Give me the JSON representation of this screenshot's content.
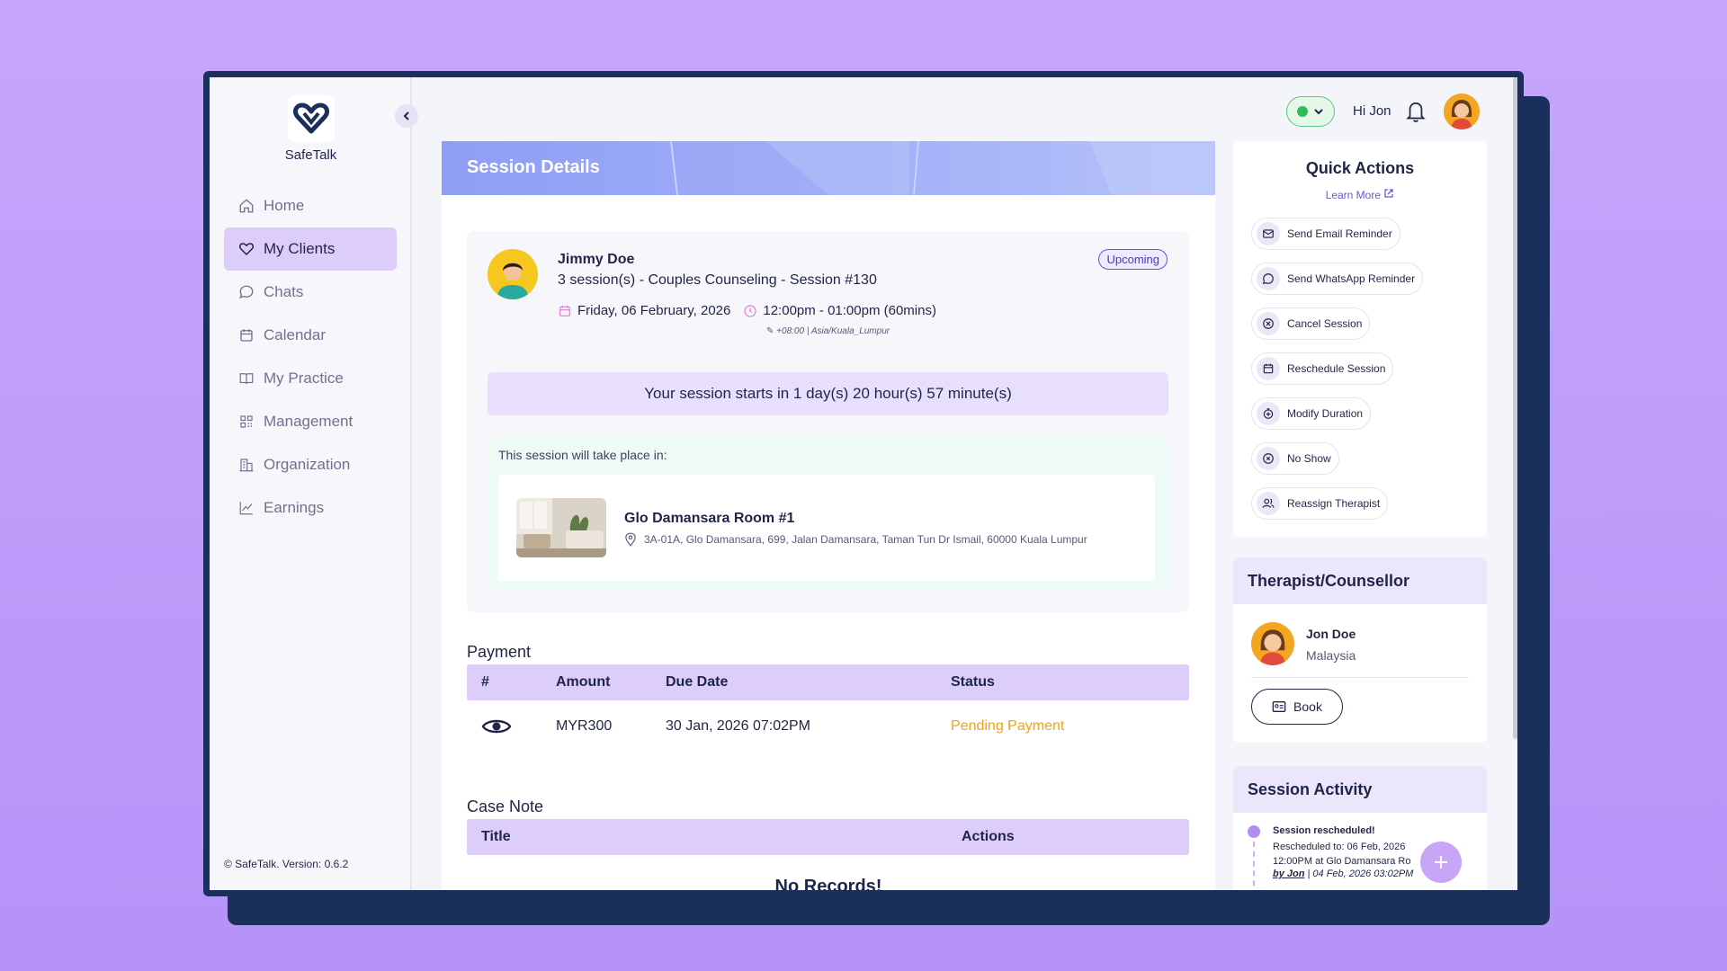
{
  "app": {
    "name": "SafeTalk",
    "copyright": "© SafeTalk. Version: 0.6.2"
  },
  "sidebar": {
    "items": [
      {
        "label": "Home",
        "icon": "home-icon"
      },
      {
        "label": "My Clients",
        "icon": "heart-icon",
        "active": true
      },
      {
        "label": "Chats",
        "icon": "chat-icon"
      },
      {
        "label": "Calendar",
        "icon": "calendar-icon"
      },
      {
        "label": "My Practice",
        "icon": "book-icon"
      },
      {
        "label": "Management",
        "icon": "grid-icon"
      },
      {
        "label": "Organization",
        "icon": "building-icon"
      },
      {
        "label": "Earnings",
        "icon": "chart-line-icon"
      }
    ]
  },
  "topbar": {
    "greeting": "Hi Jon",
    "status": "online",
    "status_color": "#2ebd55"
  },
  "session": {
    "header_title": "Session Details",
    "client_name": "Jimmy Doe",
    "client_sub": "3 session(s) - Couples Counseling - Session #130",
    "badge": "Upcoming",
    "date": "Friday, 06 February, 2026",
    "time": "12:00pm - 01:00pm (60mins)",
    "timezone": "+08:00 | Asia/Kuala_Lumpur",
    "countdown": "Your session starts in 1 day(s) 20 hour(s) 57 minute(s)",
    "location_label": "This session will take place in:",
    "room_name": "Glo Damansara Room #1",
    "room_address": "3A-01A, Glo Damansara, 699, Jalan Damansara, Taman Tun Dr Ismail, 60000 Kuala Lumpur"
  },
  "payment": {
    "title": "Payment",
    "columns": [
      "#",
      "Amount",
      "Due Date",
      "Status"
    ],
    "rows": [
      {
        "amount": "MYR300",
        "due_date": "30 Jan, 2026 07:02PM",
        "status": "Pending Payment",
        "status_color": "#f0a21b"
      }
    ]
  },
  "case_note": {
    "title": "Case Note",
    "columns": [
      "Title",
      "Actions"
    ],
    "empty": "No Records!"
  },
  "quick_actions": {
    "title": "Quick Actions",
    "learn_more": "Learn More",
    "items": [
      {
        "label": "Send Email Reminder",
        "icon": "mail-icon"
      },
      {
        "label": "Send WhatsApp Reminder",
        "icon": "whatsapp-icon"
      },
      {
        "label": "Cancel Session",
        "icon": "cancel-icon"
      },
      {
        "label": "Reschedule Session",
        "icon": "reschedule-icon"
      },
      {
        "label": "Modify Duration",
        "icon": "duration-icon"
      },
      {
        "label": "No Show",
        "icon": "no-show-icon"
      },
      {
        "label": "Reassign Therapist",
        "icon": "users-icon"
      }
    ]
  },
  "therapist": {
    "title": "Therapist/Counsellor",
    "name": "Jon Doe",
    "country": "Malaysia",
    "book_label": "Book"
  },
  "activity": {
    "title": "Session Activity",
    "event_title": "Session rescheduled!",
    "event_text": "Rescheduled to: 06 Feb, 2026 12:00PM at Glo Damansara Ro",
    "by_user": "by Jon",
    "by_time": " | 04 Feb, 2026 03:02PM"
  },
  "colors": {
    "accent": "#dccdfa",
    "navy": "#1b2f5d",
    "header": "#8f9ef4"
  }
}
